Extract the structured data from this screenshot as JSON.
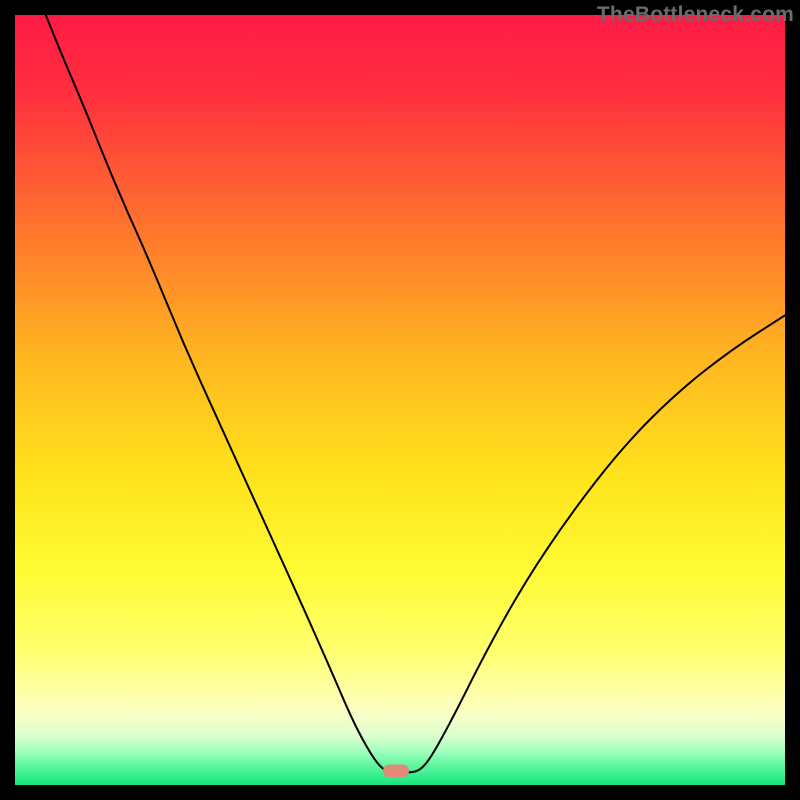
{
  "watermark": "TheBottleneck.com",
  "gradient_stops": [
    {
      "pct": 0,
      "color": "#ff1a44"
    },
    {
      "pct": 10,
      "color": "#ff2f3f"
    },
    {
      "pct": 25,
      "color": "#ff6a30"
    },
    {
      "pct": 45,
      "color": "#ffb820"
    },
    {
      "pct": 60,
      "color": "#ffe31c"
    },
    {
      "pct": 72,
      "color": "#fffb33"
    },
    {
      "pct": 82,
      "color": "#ffff6a"
    },
    {
      "pct": 88,
      "color": "#ffffa8"
    },
    {
      "pct": 91,
      "color": "#f7ffc8"
    },
    {
      "pct": 93.5,
      "color": "#dcffcc"
    },
    {
      "pct": 95.5,
      "color": "#a6ffbf"
    },
    {
      "pct": 97.5,
      "color": "#5cf7a0"
    },
    {
      "pct": 100,
      "color": "#14e57a"
    }
  ],
  "marker": {
    "x_pct": 49.5,
    "y_pct": 98.2,
    "color": "#e18a7a"
  },
  "chart_data": {
    "type": "line",
    "title": "",
    "xlabel": "",
    "ylabel": "",
    "xlim": [
      0,
      100
    ],
    "ylim": [
      0,
      100
    ],
    "note": "Axis values are estimated percent positions read from pixel coordinates; the image has no tick labels.",
    "series": [
      {
        "name": "bottleneck-curve",
        "points": [
          {
            "x": 4.0,
            "y": 100.0
          },
          {
            "x": 6.0,
            "y": 95.0
          },
          {
            "x": 9.0,
            "y": 88.0
          },
          {
            "x": 13.0,
            "y": 78.0
          },
          {
            "x": 17.5,
            "y": 68.0
          },
          {
            "x": 22.0,
            "y": 57.0
          },
          {
            "x": 27.0,
            "y": 46.0
          },
          {
            "x": 32.0,
            "y": 35.0
          },
          {
            "x": 37.0,
            "y": 24.0
          },
          {
            "x": 41.0,
            "y": 15.0
          },
          {
            "x": 44.0,
            "y": 8.0
          },
          {
            "x": 46.5,
            "y": 3.5
          },
          {
            "x": 48.0,
            "y": 1.8
          },
          {
            "x": 49.5,
            "y": 1.6
          },
          {
            "x": 51.0,
            "y": 1.6
          },
          {
            "x": 52.5,
            "y": 1.8
          },
          {
            "x": 54.0,
            "y": 3.5
          },
          {
            "x": 57.0,
            "y": 9.0
          },
          {
            "x": 61.0,
            "y": 17.0
          },
          {
            "x": 66.0,
            "y": 26.0
          },
          {
            "x": 72.0,
            "y": 35.0
          },
          {
            "x": 79.0,
            "y": 44.0
          },
          {
            "x": 86.0,
            "y": 51.0
          },
          {
            "x": 93.0,
            "y": 56.5
          },
          {
            "x": 100.0,
            "y": 61.0
          }
        ]
      }
    ],
    "marker_point": {
      "x": 49.5,
      "y": 1.6
    }
  }
}
